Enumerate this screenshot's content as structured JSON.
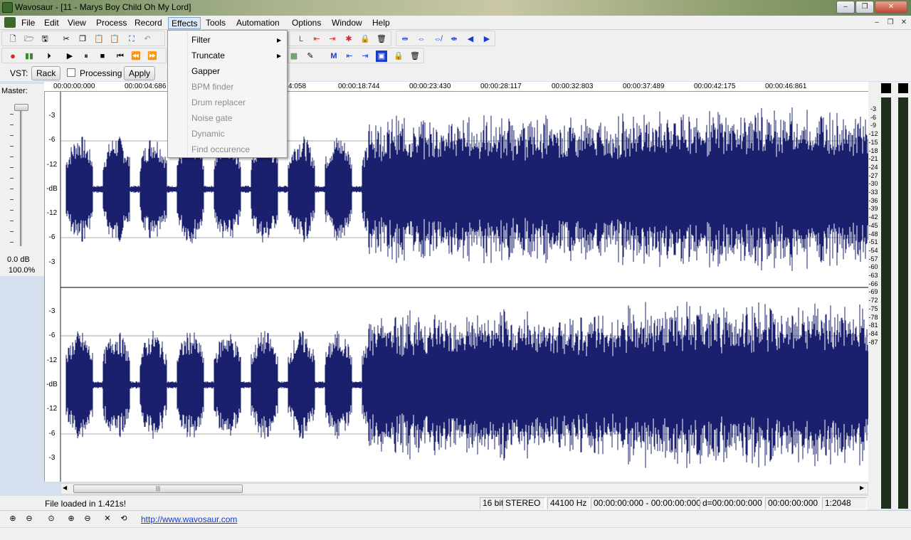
{
  "window": {
    "title": "Wavosaur - [11 - Marys Boy Child  Oh My Lord]",
    "controls": [
      "‒",
      "❐",
      "✕"
    ]
  },
  "menubar": {
    "items": [
      "File",
      "Edit",
      "View",
      "Process",
      "Record",
      "Effects",
      "Tools",
      "Automation",
      "Options",
      "Window",
      "Help"
    ],
    "active": "Effects",
    "mdi_controls": [
      "‒",
      "❐",
      "✕"
    ]
  },
  "effects_menu": {
    "items": [
      {
        "label": "Filter",
        "enabled": true,
        "submenu": true
      },
      {
        "label": "Truncate",
        "enabled": true,
        "submenu": true
      },
      {
        "label": "Gapper",
        "enabled": true,
        "submenu": false
      },
      {
        "label": "BPM finder",
        "enabled": false,
        "submenu": false
      },
      {
        "label": "Drum replacer",
        "enabled": false,
        "submenu": false
      },
      {
        "label": "Noise gate",
        "enabled": false,
        "submenu": false
      },
      {
        "label": "Dynamic",
        "enabled": false,
        "submenu": false
      },
      {
        "label": "Find occurence",
        "enabled": false,
        "submenu": false
      }
    ]
  },
  "vst": {
    "label": "VST:",
    "rack_label": "Rack",
    "processing_label": "Processing",
    "processing_checked": false,
    "apply_label": "Apply"
  },
  "master": {
    "label": "Master:",
    "db": "0.0 dB",
    "percent": "100.0%"
  },
  "timeline": {
    "labels": [
      "00:00:00:000",
      "00:00:04:686",
      "4:058",
      "00:00:18:744",
      "00:00:23:430",
      "00:00:28:117",
      "00:00:32:803",
      "00:00:37:489",
      "00:00:42:175",
      "00:00:46:861"
    ]
  },
  "channel_axis": {
    "labels": [
      "-3",
      "-6",
      "-12",
      "-dB",
      "-12",
      "-6",
      "-3"
    ]
  },
  "vu_scale": {
    "labels": [
      "-3",
      "-6",
      "-9",
      "-12",
      "-15",
      "-18",
      "-21",
      "-24",
      "-27",
      "-30",
      "-33",
      "-36",
      "-39",
      "-42",
      "-45",
      "-48",
      "-51",
      "-54",
      "-57",
      "-60",
      "-63",
      "-66",
      "-69",
      "-72",
      "-75",
      "-78",
      "-81",
      "-84",
      "-87"
    ]
  },
  "status": {
    "message": "File loaded in 1.421s!",
    "bits": "16 bit",
    "channels": "STEREO",
    "rate": "44100 Hz",
    "selection": "00:00:00:000 - 00:00:00:000",
    "duration": "d=00:00:00:000",
    "cursor": "00:00:00:000",
    "zoom": "1:2048"
  },
  "footer": {
    "link": "http://www.wavosaur.com"
  },
  "colors": {
    "waveform": "#1a1f6e",
    "accent_blue": "#1a3cc8",
    "accent_red": "#d8262d"
  }
}
